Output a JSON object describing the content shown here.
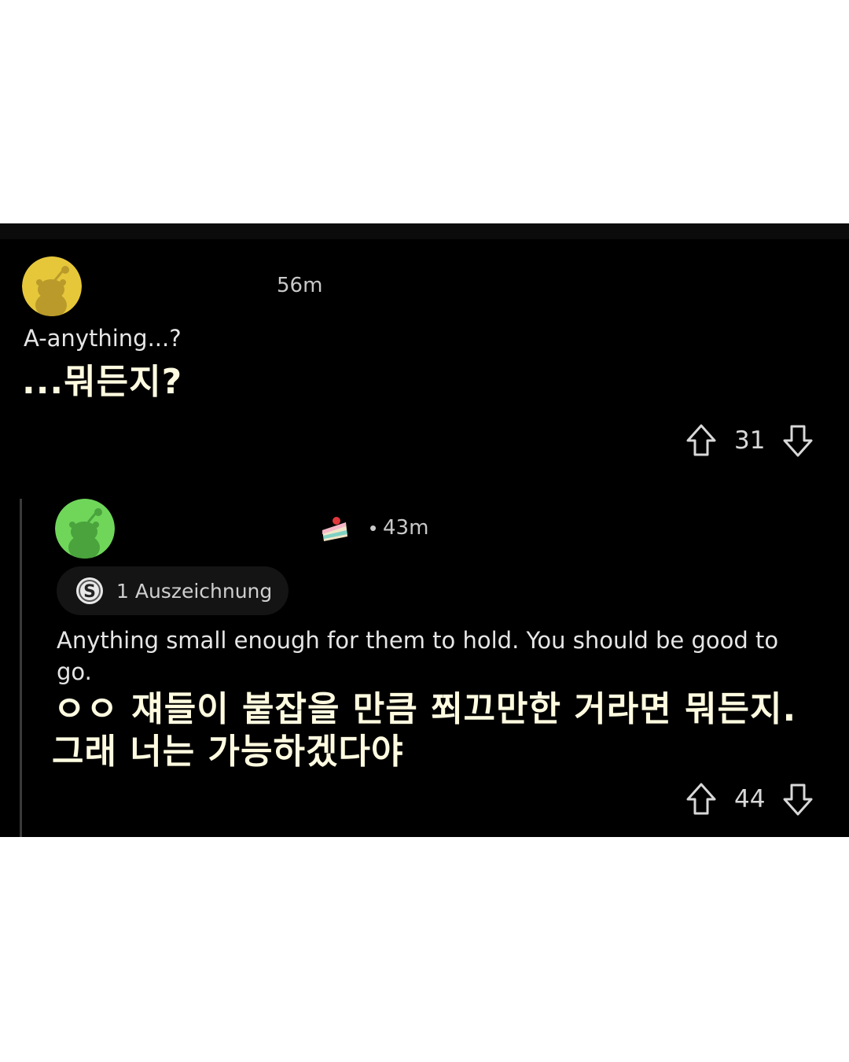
{
  "post1": {
    "avatar_color": "#e6c73a",
    "time": "56m",
    "text_en": "A-anything...?",
    "text_ko": "...뭐든지?",
    "vote_count": "31"
  },
  "post2": {
    "avatar_color": "#6fd65a",
    "flair_icon": "cake-slice-icon",
    "time_sep": "•",
    "time": "43m",
    "award_icon": "award-s-icon",
    "award_label": "1 Auszeichnung",
    "text_en": "Anything small enough for them to hold. You should be good to go.",
    "text_ko_line1": "ㅇㅇ 쟤들이 붙잡을 만큼 쬐끄만한 거라면 뭐든지.",
    "text_ko_line2": "그래 너는 가능하겠다야",
    "vote_count": "44"
  },
  "colors": {
    "background": "#000000",
    "subtitle": "#fffbe0"
  }
}
